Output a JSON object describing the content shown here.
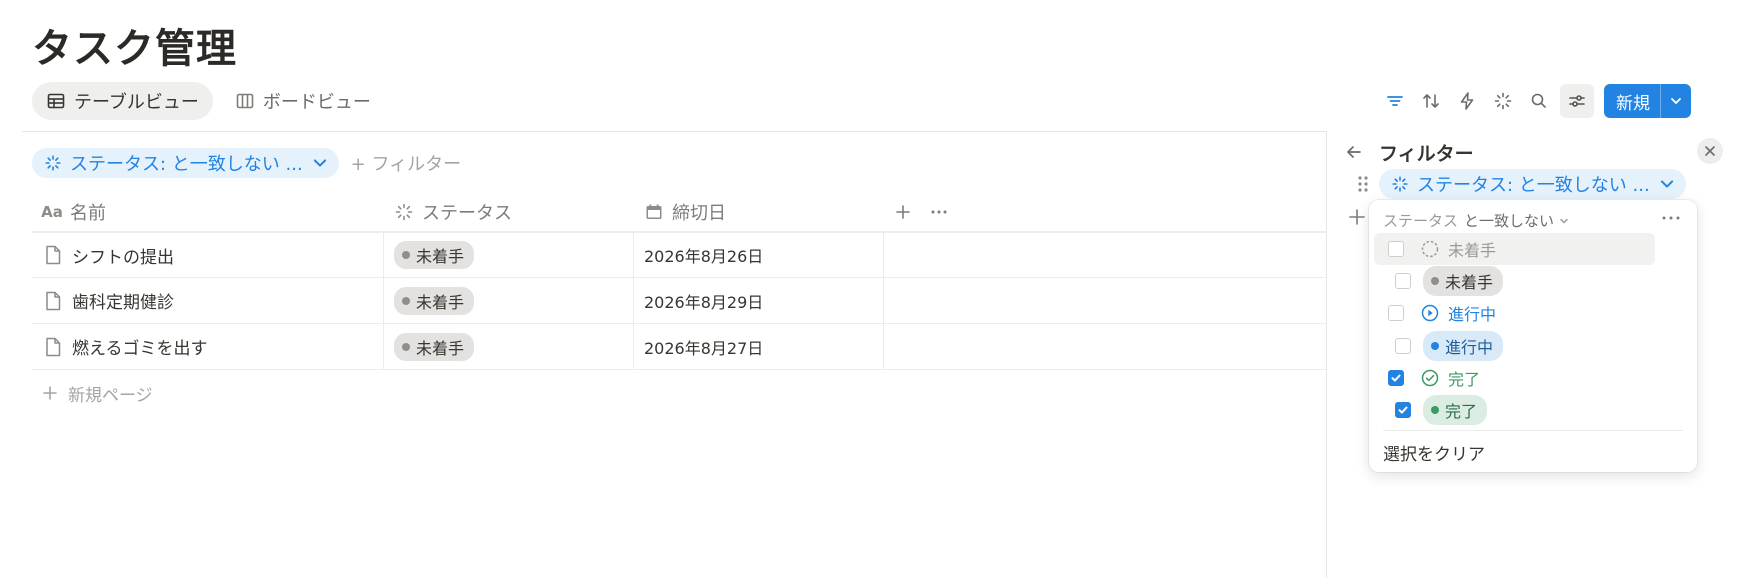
{
  "page": {
    "title": "タスク管理"
  },
  "views": [
    {
      "label": "テーブルビュー",
      "icon": "table-icon",
      "active": true
    },
    {
      "label": "ボードビュー",
      "icon": "board-icon",
      "active": false
    }
  ],
  "toolbar": {
    "icons": [
      "filter-icon",
      "sort-icon",
      "automation-icon",
      "status-icon",
      "search-icon",
      "settings-icon"
    ],
    "new_label": "新規"
  },
  "filter_bar": {
    "chip_label": "ステータス: と一致しない ...",
    "add_filter_label": "+ フィルター"
  },
  "table": {
    "columns": [
      {
        "label": "名前",
        "icon": "Aa"
      },
      {
        "label": "ステータス",
        "icon": "status-icon"
      },
      {
        "label": "締切日",
        "icon": "calendar-icon"
      }
    ],
    "rows": [
      {
        "name": "シフトの提出",
        "status": "未着手",
        "due": "2026年8月26日"
      },
      {
        "name": "歯科定期健診",
        "status": "未着手",
        "due": "2026年8月29日"
      },
      {
        "name": "燃えるゴミを出す",
        "status": "未着手",
        "due": "2026年8月27日"
      }
    ],
    "new_page_label": "新規ページ"
  },
  "filter_panel": {
    "title": "フィルター",
    "rule_chip_label": "ステータス: と一致しない ..."
  },
  "dropdown": {
    "property": "ステータス",
    "condition": "と一致しない",
    "options": [
      {
        "label": "未着手",
        "kind": "group",
        "checked": false,
        "color": "#9b9a97"
      },
      {
        "label": "未着手",
        "kind": "value",
        "checked": false,
        "color": "#8f8e8a",
        "bg": "#e3e2e0"
      },
      {
        "label": "進行中",
        "kind": "group",
        "checked": false,
        "color": "#2383e2"
      },
      {
        "label": "進行中",
        "kind": "value",
        "checked": false,
        "color": "#2383e2",
        "bg": "#d8e9f8"
      },
      {
        "label": "完了",
        "kind": "group",
        "checked": true,
        "color": "#3b9a66"
      },
      {
        "label": "完了",
        "kind": "value",
        "checked": true,
        "color": "#3b9a66",
        "bg": "#dbece2"
      }
    ],
    "clear_label": "選択をクリア"
  },
  "colors": {
    "accent": "#2383e2",
    "done": "#3b9a66",
    "todo": "#8f8e8a"
  }
}
